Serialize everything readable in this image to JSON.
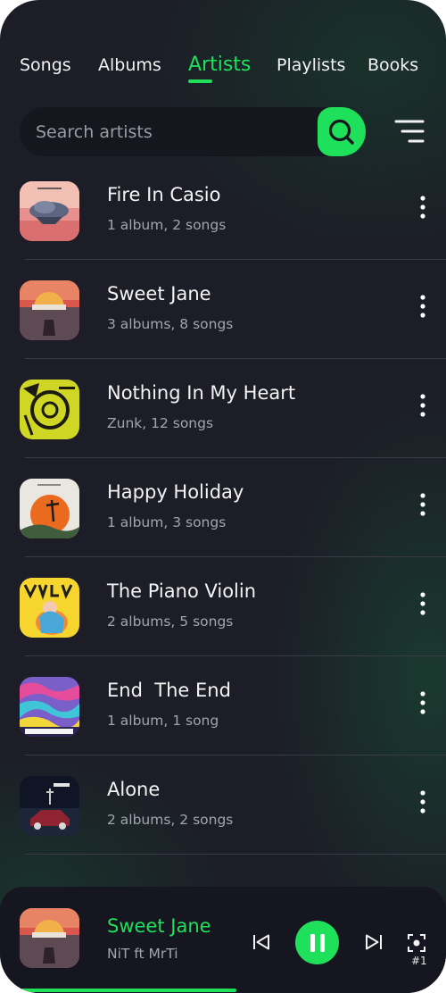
{
  "tabs": [
    {
      "label": "Songs",
      "active": false
    },
    {
      "label": "Albums",
      "active": false
    },
    {
      "label": "Artists",
      "active": true
    },
    {
      "label": "Playlists",
      "active": false
    },
    {
      "label": "Books",
      "active": false
    }
  ],
  "search": {
    "placeholder": "Search artists",
    "value": ""
  },
  "artists": [
    {
      "name": "Fire In Casio",
      "meta": "1 album, 2 songs"
    },
    {
      "name": "Sweet Jane",
      "meta": "3 albums, 8 songs"
    },
    {
      "name": "Nothing In My Heart",
      "meta": "Zunk, 12 songs"
    },
    {
      "name": "Happy Holiday",
      "meta": "1 album, 3 songs"
    },
    {
      "name": "The Piano Violin",
      "meta": "2 albums, 5 songs"
    },
    {
      "name": "End  The End",
      "meta": "1 album, 1 song"
    },
    {
      "name": "Alone",
      "meta": "2 albums, 2 songs"
    }
  ],
  "now_playing": {
    "title": "Sweet Jane",
    "artist": "NiT ft MrTi",
    "queue_label": "#1",
    "progress": 0.53,
    "state": "playing"
  },
  "colors": {
    "accent": "#1fe05a",
    "background": "#1c1d27",
    "player_background": "#15161f"
  },
  "icons": [
    "search-icon",
    "sort-icon",
    "more-vertical-icon",
    "previous-icon",
    "pause-icon",
    "next-icon",
    "queue-focus-icon"
  ]
}
